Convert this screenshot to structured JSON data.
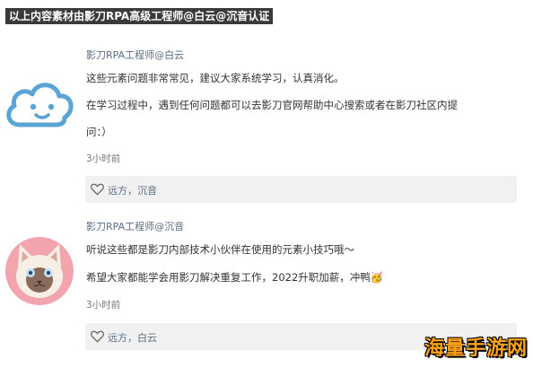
{
  "banner": "以上内容素材由影刀RPA高级工程师@白云@沉音认证",
  "comments": [
    {
      "author": "影刀RPA工程师@白云",
      "lines": [
        "这些元素问题非常常见，建议大家系统学习，认真消化。",
        "在学习过程中，遇到任何问题都可以去影刀官网帮助中心搜索或者在影刀社区内提",
        "问：）"
      ],
      "time": "3小时前",
      "likes": "远方，沉音",
      "avatar_icon": "cloud-face-icon"
    },
    {
      "author": "影刀RPA工程师@沉音",
      "lines": [
        "听说这些都是影刀内部技术小伙伴在使用的元素小技巧哦～",
        "希望大家都能学会用影刀解决重复工作，2022升职加薪，冲鸭🥳"
      ],
      "time": "3小时前",
      "likes": "远方，白云",
      "avatar_icon": "siamese-cat-icon"
    }
  ],
  "watermark": "海量手游网",
  "colors": {
    "author": "#5a6e85",
    "cloud": "#5aa5d6",
    "like_bg": "#f1f1f1",
    "watermark": "#ffa21a"
  }
}
